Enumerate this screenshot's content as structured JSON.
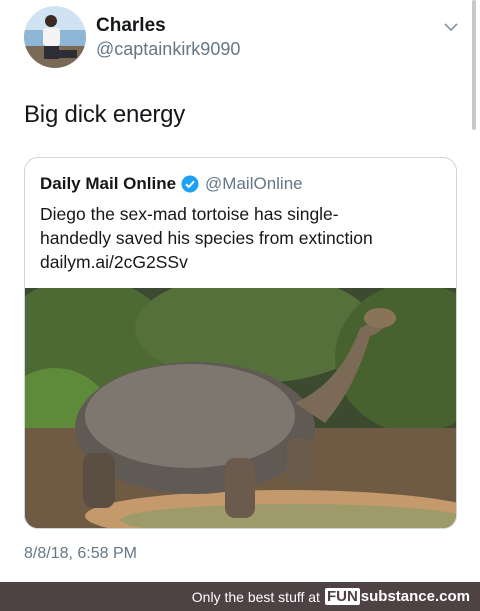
{
  "tweet": {
    "author": {
      "name": "Charles",
      "handle": "@captainkirk9090",
      "avatar_icon": "user-avatar-photo"
    },
    "menu_icon": "chevron-down-icon",
    "text": "Big dick energy",
    "timestamp": "8/8/18, 6:58 PM"
  },
  "quoted_tweet": {
    "author": {
      "name": "Daily Mail Online",
      "handle": "@MailOnline",
      "verified": true,
      "verified_color": "#1da1f2"
    },
    "text_line_1": "Diego the sex-mad tortoise has single-",
    "text_line_2": "handedly saved his species from extinction",
    "link": "dailym.ai/2cG2SSv",
    "image_icon": "giant-tortoise-photo"
  },
  "footer": {
    "tagline": "Only the best stuff at",
    "brand_part1": "FUN",
    "brand_part2": "substance",
    "brand_part3": ".com",
    "background": "#4f4245"
  }
}
